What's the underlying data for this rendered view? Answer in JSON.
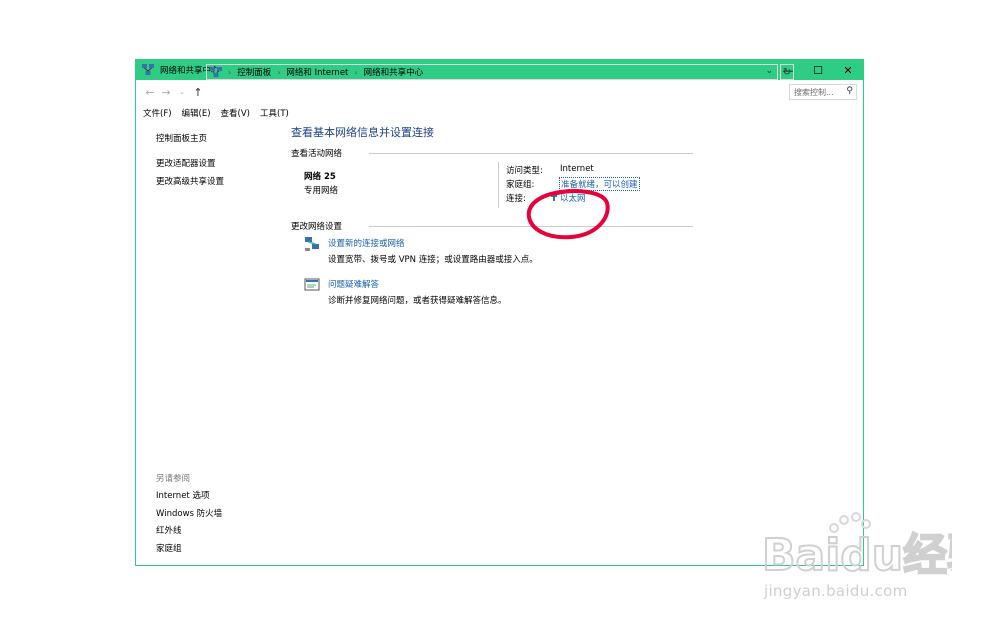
{
  "window": {
    "title": "网络和共享中心",
    "controls": {
      "minimize": "—",
      "maximize": "☐",
      "close": "✕"
    }
  },
  "address": {
    "breadcrumbs": [
      "控制面板",
      "网络和 Internet",
      "网络和共享中心"
    ],
    "search_placeholder": "搜索控制..."
  },
  "menu": {
    "items": [
      "文件(F)",
      "编辑(E)",
      "查看(V)",
      "工具(T)"
    ]
  },
  "sidebar": {
    "items": [
      "控制面板主页",
      "更改适配器设置",
      "更改高级共享设置"
    ],
    "see_also_title": "另请参阅",
    "see_also": [
      "Internet 选项",
      "Windows 防火墙",
      "红外线",
      "家庭组"
    ]
  },
  "main": {
    "title": "查看基本网络信息并设置连接",
    "active_section": "查看活动网络",
    "network": {
      "name": "网络 25",
      "type": "专用网络",
      "access_type_label": "访问类型:",
      "access_type_value": "Internet",
      "homegroup_label": "家庭组:",
      "homegroup_value": "准备就绪，可以创建",
      "connection_label": "连接:",
      "connection_value": "以太网"
    },
    "change_section": "更改网络设置",
    "tasks": [
      {
        "title": "设置新的连接或网络",
        "desc": "设置宽带、拨号或 VPN 连接；或设置路由器或接入点。",
        "icon": "network-setup-icon"
      },
      {
        "title": "问题疑难解答",
        "desc": "诊断并修复网络问题，或者获得疑难解答信息。",
        "icon": "troubleshoot-icon"
      }
    ]
  },
  "watermark": {
    "brand": "Baidu经验",
    "url": "jingyan.baidu.com"
  },
  "colors": {
    "titlebar": "#2ecc85",
    "link": "#1a5fb4",
    "heading": "#1e3f8a",
    "annotation": "#e8003a"
  }
}
